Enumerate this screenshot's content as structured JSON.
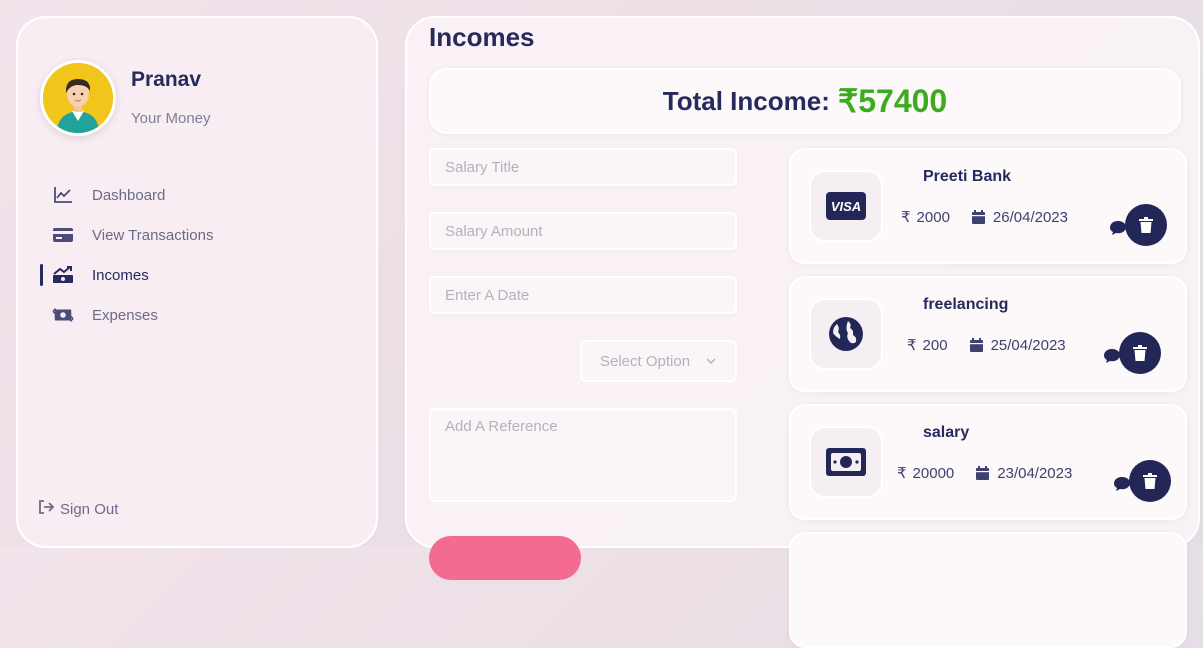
{
  "user": {
    "name": "Pranav",
    "subtitle": "Your Money"
  },
  "nav": [
    {
      "label": "Dashboard",
      "icon": "chart-line-icon",
      "active": false
    },
    {
      "label": "View Transactions",
      "icon": "credit-card-icon",
      "active": false
    },
    {
      "label": "Incomes",
      "icon": "money-bill-trend-icon",
      "active": true
    },
    {
      "label": "Expenses",
      "icon": "money-bill-transfer-icon",
      "active": false
    }
  ],
  "sign_out": {
    "label": "Sign Out",
    "icon": "sign-out-icon"
  },
  "page": {
    "title": "Incomes",
    "total_label": "Total Income:",
    "total_value": "₹57400",
    "total_color": "#3cab1e"
  },
  "form": {
    "title_placeholder": "Salary Title",
    "amount_placeholder": "Salary Amount",
    "date_placeholder": "Enter A Date",
    "select_label": "Select Option",
    "reference_placeholder": "Add A Reference",
    "submit_color": "#f36b90"
  },
  "incomes": [
    {
      "title": "Preeti Bank",
      "currency": "₹",
      "amount": "2000",
      "date": "26/04/2023",
      "icon": "visa-card-icon"
    },
    {
      "title": "freelancing",
      "currency": "₹",
      "amount": "200",
      "date": "25/04/2023",
      "icon": "globe-icon"
    },
    {
      "title": "salary",
      "currency": "₹",
      "amount": "20000",
      "date": "23/04/2023",
      "icon": "money-bill-icon"
    }
  ],
  "colors": {
    "primary": "#232758",
    "muted": "#6a6c86"
  }
}
